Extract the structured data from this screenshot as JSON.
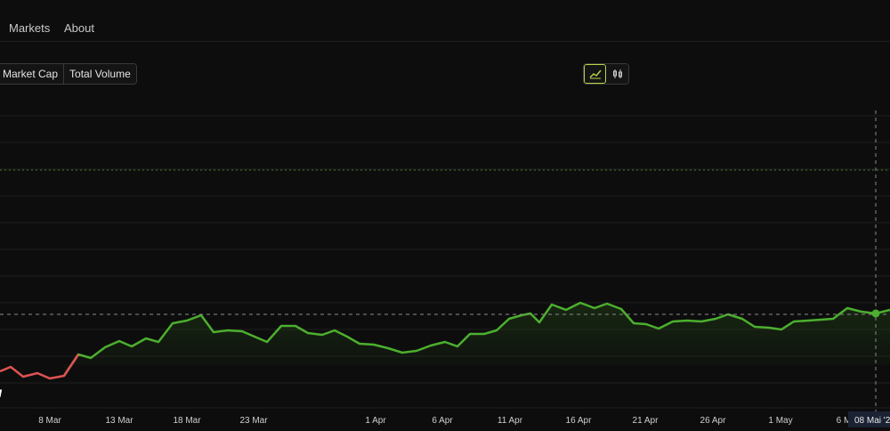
{
  "nav": {
    "items": [
      {
        "label": "Markets"
      },
      {
        "label": "About"
      }
    ]
  },
  "toggles": {
    "market_cap": "Market Cap",
    "total_volume": "Total Volume"
  },
  "chart_type": {
    "options": [
      "line-chart-icon",
      "candlestick-icon"
    ],
    "active": "line-chart-icon"
  },
  "chart_data": {
    "type": "line",
    "x_ticks": [
      "8 Mar",
      "13 Mar",
      "18 Mar",
      "23 Mar",
      "1 Apr",
      "6 Apr",
      "11 Apr",
      "16 Apr",
      "21 Apr",
      "26 Apr",
      "1 May",
      "6 M"
    ],
    "crosshair_label": "08 Mai '2",
    "watermark_text": "ı",
    "colors": {
      "up": "#4caf2e",
      "down": "#e05252",
      "grid": "#1f1f1f",
      "dotted": "#3e7a24"
    },
    "grid": true
  }
}
